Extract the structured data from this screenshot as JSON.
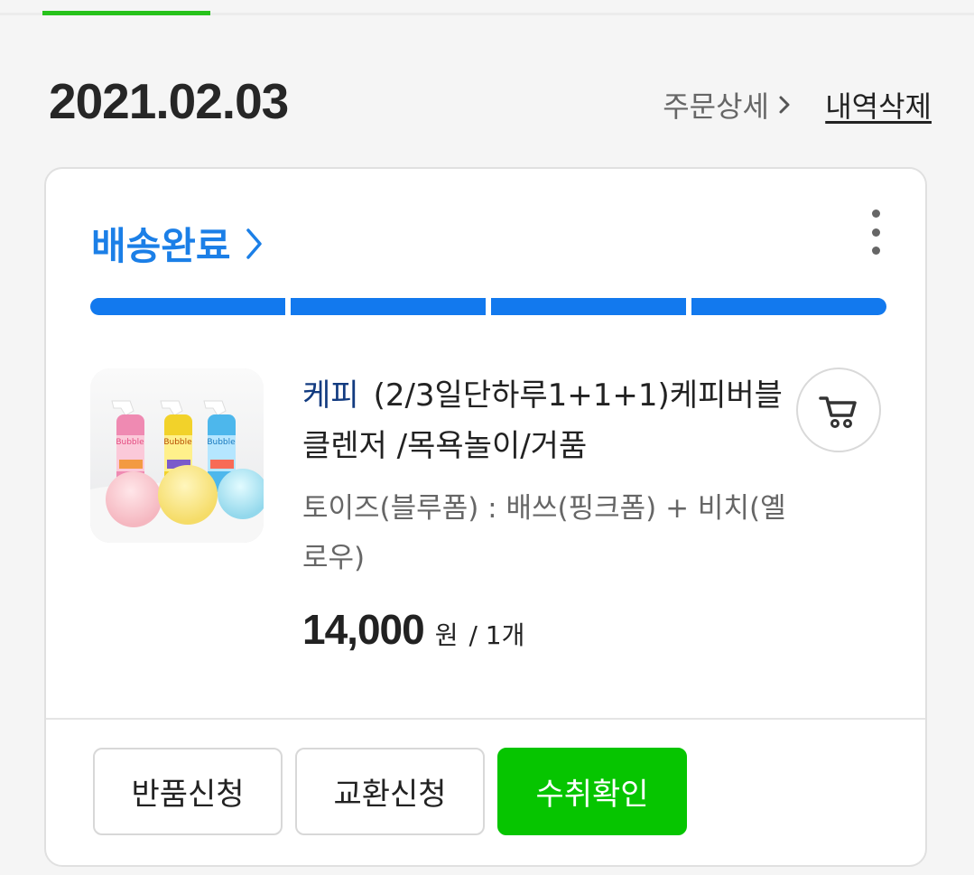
{
  "order": {
    "date": "2021.02.03",
    "detail_link": "주문상세",
    "delete_link": "내역삭제"
  },
  "delivery": {
    "status": "배송완료",
    "progress_completed_fraction": 1,
    "progress_steps": 4
  },
  "product": {
    "brand": "케피",
    "name": "(2/3일단하루1+1+1)케피버블 클렌저 /목욕놀이/거품",
    "option": "토이즈(블루폼) : 배쓰(핑크폼) + 비치(옐로우)",
    "price": "14,000",
    "currency": "원",
    "quantity": "/ 1개",
    "image_alt": "Pastel bubble cleanser bottles with foam balls"
  },
  "actions": {
    "return_label": "반품신청",
    "exchange_label": "교환신청",
    "confirm_label": "수취확인"
  },
  "icons": {
    "detail": "chevron-right-icon",
    "status": "chevron-right-icon",
    "more": "more-vertical-icon",
    "cart": "shopping-cart-icon"
  },
  "colors": {
    "active_tab": "#27c21b",
    "status_blue": "#1b7fe7",
    "progress_blue": "#1279ee",
    "confirm_green": "#06c500"
  }
}
